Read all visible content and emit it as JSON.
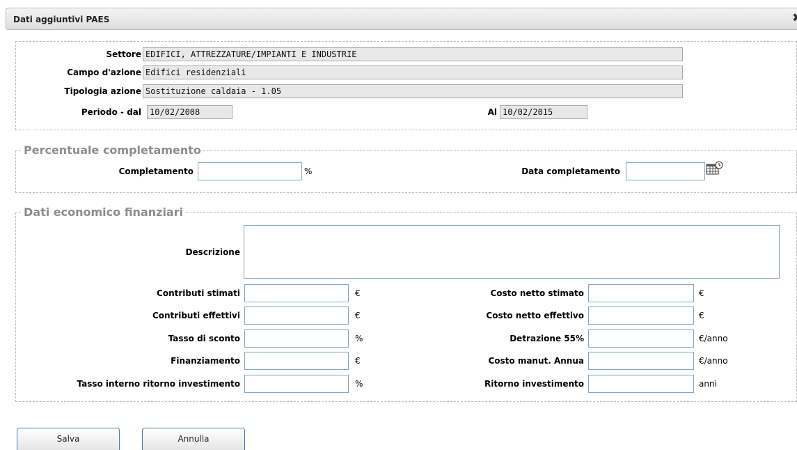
{
  "dialog": {
    "title": "Dati aggiuntivi PAES",
    "close_icon": "close-icon"
  },
  "info": {
    "settore_label": "Settore",
    "settore_value": "EDIFICI, ATTREZZATURE/IMPIANTI E INDUSTRIE",
    "campo_label": "Campo d'azione",
    "campo_value": "Edifici residenziali",
    "tipologia_label": "Tipologia azione",
    "tipologia_value": "Sostituzione caldaia - 1.05",
    "periodo_label": "Periodo - dal",
    "periodo_dal": "10/02/2008",
    "al_label": "Al",
    "periodo_al": "10/02/2015"
  },
  "completamento": {
    "legend": "Percentuale completamento",
    "completamento_label": "Completamento",
    "completamento_value": "",
    "completamento_unit": "%",
    "data_label": "Data completamento",
    "data_value": "",
    "calendar_icon": "calendar-icon"
  },
  "economico": {
    "legend": "Dati economico finanziari",
    "descrizione_label": "Descrizione",
    "descrizione_value": "",
    "left": [
      {
        "label": "Contributi stimati",
        "value": "",
        "unit": "€"
      },
      {
        "label": "Contributi effettivi",
        "value": "",
        "unit": "€"
      },
      {
        "label": "Tasso di sconto",
        "value": "",
        "unit": "%"
      },
      {
        "label": "Finanziamento",
        "value": "",
        "unit": "€"
      },
      {
        "label": "Tasso interno ritorno investimento",
        "value": "",
        "unit": "%"
      }
    ],
    "right": [
      {
        "label": "Costo netto stimato",
        "value": "",
        "unit": "€"
      },
      {
        "label": "Costo netto effettivo",
        "value": "",
        "unit": "€"
      },
      {
        "label": "Detrazione 55%",
        "value": "",
        "unit": "€/anno"
      },
      {
        "label": "Costo manut. Annua",
        "value": "",
        "unit": "€/anno"
      },
      {
        "label": "Ritorno investimento",
        "value": "",
        "unit": "anni"
      }
    ]
  },
  "buttons": {
    "save_label": "Salva",
    "cancel_label": "Annulla"
  }
}
